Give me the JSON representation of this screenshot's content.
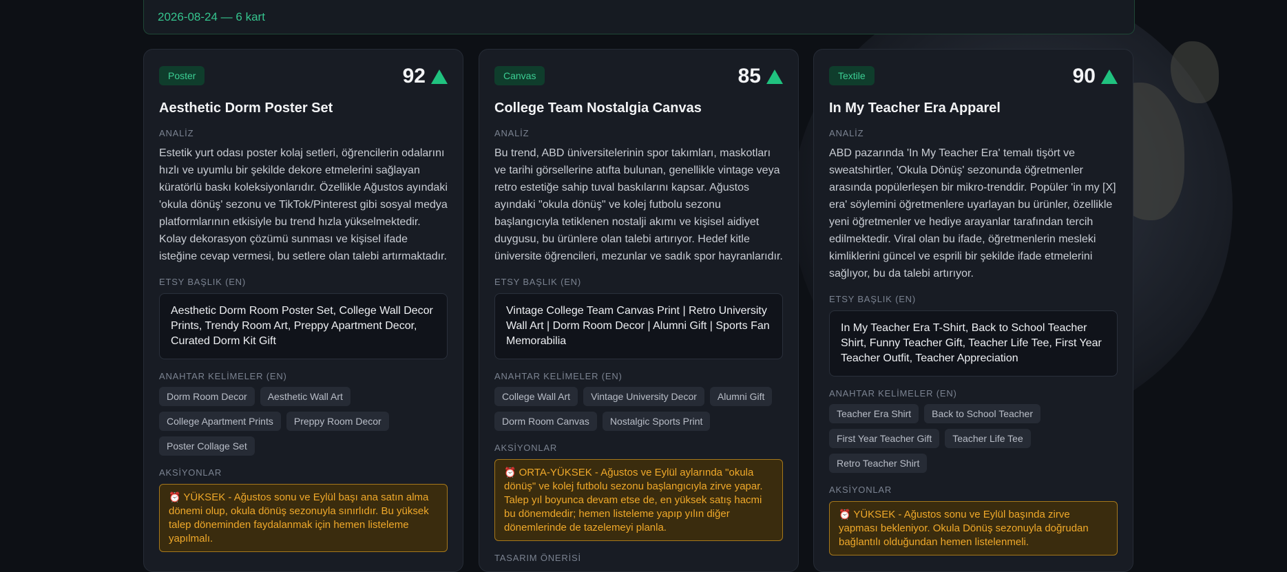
{
  "header": {
    "text": "2026-08-24 — 6 kart"
  },
  "cards": [
    {
      "category": "Poster",
      "score": "92",
      "title": "Aesthetic Dorm Poster Set",
      "analysis_label": "ANALİZ",
      "analysis": "Estetik yurt odası poster kolaj setleri, öğrencilerin odalarını hızlı ve uyumlu bir şekilde dekore etmelerini sağlayan küratörlü baskı koleksiyonlarıdır. Özellikle Ağustos ayındaki 'okula dönüş' sezonu ve TikTok/Pinterest gibi sosyal medya platformlarının etkisiyle bu trend hızla yükselmektedir. Kolay dekorasyon çözümü sunması ve kişisel ifade isteğine cevap vermesi, bu setlere olan talebi artırmaktadır.",
      "etsy_label": "ETSY BAŞLIK (EN)",
      "etsy_title": "Aesthetic Dorm Room Poster Set, College Wall Decor Prints, Trendy Room Art, Preppy Apartment Decor, Curated Dorm Kit Gift",
      "keywords_label": "ANAHTAR KELİMELER (EN)",
      "keywords": [
        "Dorm Room Decor",
        "Aesthetic Wall Art",
        "College Apartment Prints",
        "Preppy Room Decor",
        "Poster Collage Set"
      ],
      "actions_label": "AKSİYONLAR",
      "action_icon": "⏰",
      "action": "YÜKSEK - Ağustos sonu ve Eylül başı ana satın alma dönemi olup, okula dönüş sezonuyla sınırlıdır. Bu yüksek talep döneminden faydalanmak için hemen listeleme yapılmalı."
    },
    {
      "category": "Canvas",
      "score": "85",
      "title": "College Team Nostalgia Canvas",
      "analysis_label": "ANALİZ",
      "analysis": "Bu trend, ABD üniversitelerinin spor takımları, maskotları ve tarihi görsellerine atıfta bulunan, genellikle vintage veya retro estetiğe sahip tuval baskılarını kapsar. Ağustos ayındaki \"okula dönüş\" ve kolej futbolu sezonu başlangıcıyla tetiklenen nostalji akımı ve kişisel aidiyet duygusu, bu ürünlere olan talebi artırıyor. Hedef kitle üniversite öğrencileri, mezunlar ve sadık spor hayranlarıdır.",
      "etsy_label": "ETSY BAŞLIK (EN)",
      "etsy_title": "Vintage College Team Canvas Print | Retro University Wall Art | Dorm Room Decor | Alumni Gift | Sports Fan Memorabilia",
      "keywords_label": "ANAHTAR KELİMELER (EN)",
      "keywords": [
        "College Wall Art",
        "Vintage University Decor",
        "Alumni Gift",
        "Dorm Room Canvas",
        "Nostalgic Sports Print"
      ],
      "actions_label": "AKSİYONLAR",
      "action_icon": "⏰",
      "action": "ORTA-YÜKSEK - Ağustos ve Eylül aylarında \"okula dönüş\" ve kolej futbolu sezonu başlangıcıyla zirve yapar. Talep yıl boyunca devam etse de, en yüksek satış hacmi bu dönemdedir; hemen listeleme yapıp yılın diğer dönemlerinde de tazelemeyi planla.",
      "design_label": "TASARIM ÖNERİSİ"
    },
    {
      "category": "Textile",
      "score": "90",
      "title": "In My Teacher Era Apparel",
      "analysis_label": "ANALİZ",
      "analysis": "ABD pazarında 'In My Teacher Era' temalı tişört ve sweatshirtler, 'Okula Dönüş' sezonunda öğretmenler arasında popülerleşen bir mikro-trenddir. Popüler 'in my [X] era' söylemini öğretmenlere uyarlayan bu ürünler, özellikle yeni öğretmenler ve hediye arayanlar tarafından tercih edilmektedir. Viral olan bu ifade, öğretmenlerin mesleki kimliklerini güncel ve esprili bir şekilde ifade etmelerini sağlıyor, bu da talebi artırıyor.",
      "etsy_label": "ETSY BAŞLIK (EN)",
      "etsy_title": "In My Teacher Era T-Shirt, Back to School Teacher Shirt, Funny Teacher Gift, Teacher Life Tee, First Year Teacher Outfit, Teacher Appreciation",
      "keywords_label": "ANAHTAR KELİMELER (EN)",
      "keywords": [
        "Teacher Era Shirt",
        "Back to School Teacher",
        "First Year Teacher Gift",
        "Teacher Life Tee",
        "Retro Teacher Shirt"
      ],
      "actions_label": "AKSİYONLAR",
      "action_icon": "⏰",
      "action": "YÜKSEK - Ağustos sonu ve Eylül başında zirve yapması bekleniyor. Okula Dönüş sezonuyla doğrudan bağlantılı olduğundan hemen listelenmeli."
    }
  ]
}
